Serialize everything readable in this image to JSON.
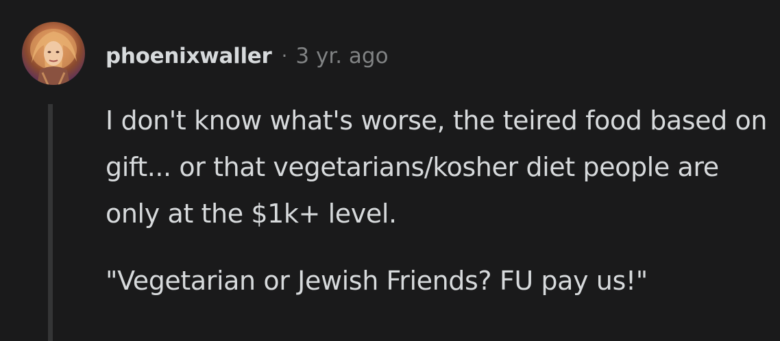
{
  "comment": {
    "author": "phoenixwaller",
    "separator": "·",
    "timestamp": "3 yr. ago",
    "avatar_icon": "user-avatar-icon",
    "paragraphs": [
      "I don't know what's worse, the teired food based on gift... or that vegetarians/kosher diet people are only at the $1k+ level.",
      "\"Vegetarian or Jewish Friends? FU pay us!\""
    ]
  },
  "colors": {
    "background": "#1a1a1b",
    "text": "#d7dadc",
    "meta": "#818384",
    "thread_line": "#343536"
  }
}
